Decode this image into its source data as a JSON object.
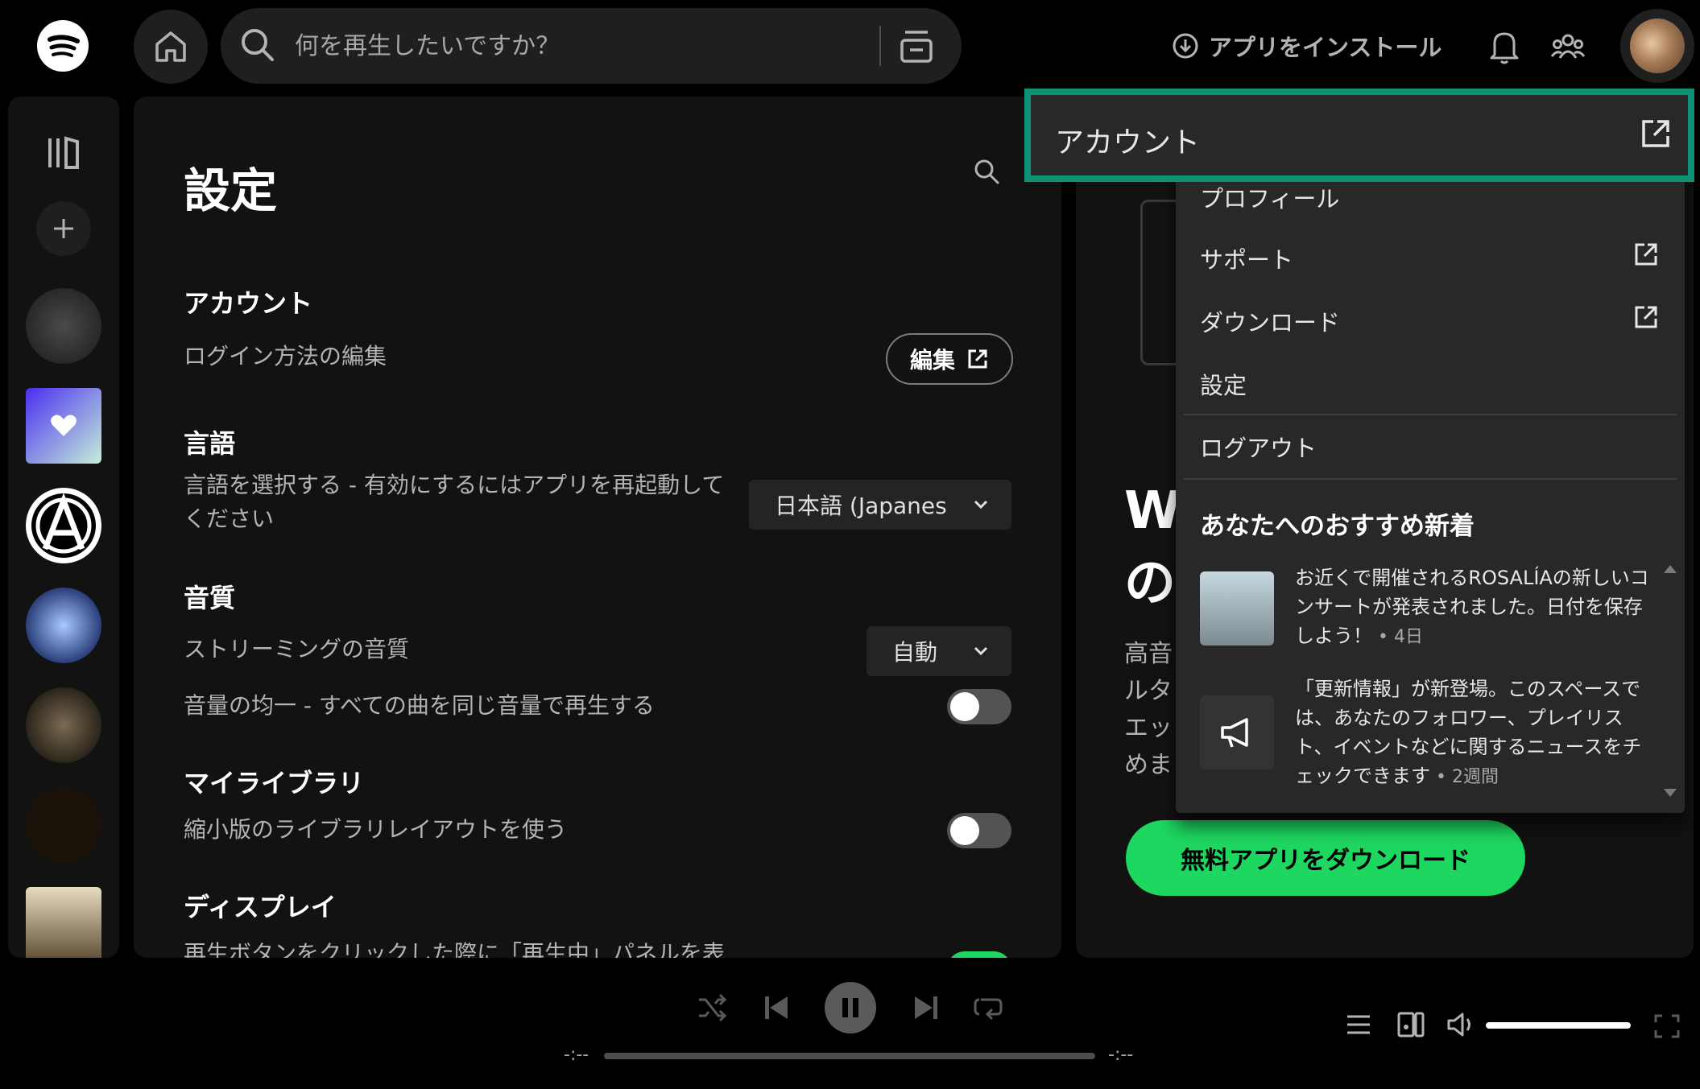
{
  "topbar": {
    "search_placeholder": "何を再生したいですか？",
    "install_label": "アプリをインストール"
  },
  "settings": {
    "title": "設定",
    "account": {
      "heading": "アカウント",
      "row": "ログイン方法の編集",
      "button": "編集"
    },
    "language": {
      "heading": "言語",
      "row_line1": "言語を選択する - 有効にするにはアプリを再起動して",
      "row_line2": "ください",
      "selected": "日本語 (Japanes"
    },
    "quality": {
      "heading": "音質",
      "streaming": "ストリーミングの音質",
      "streaming_value": "自動",
      "normalize": "音量の均一 - すべての曲を同じ音量で再生する"
    },
    "library": {
      "heading": "マイライブラリ",
      "compact": "縮小版のライブラリレイアウトを使う"
    },
    "display": {
      "heading": "ディスプレイ",
      "row_partial": "再生ボタンをクリックした際に「再生中」パネルを表"
    }
  },
  "right_panel": {
    "big_text_1": "W",
    "big_text_2": "の",
    "jp_1": "高音",
    "jp_2": "ルタ",
    "jp_3": "エッ",
    "jp_4": "めま",
    "download_button": "無料アプリをダウンロード"
  },
  "menu": {
    "account": "アカウント",
    "profile": "プロフィール",
    "support": "サポート",
    "download": "ダウンロード",
    "settings": "設定",
    "logout": "ログアウト",
    "notifications_title": "あなたへのおすすめ新着",
    "notif1_text": "お近くで開催されるROSALÍAの新しいコンサートが発表されました。日付を保存しよう！",
    "notif1_time": " • 4日",
    "notif2_text": "「更新情報」が新登場。このスペースでは、あなたのフォロワー、プレイリスト、イベントなどに関するニュースをチェックできます",
    "notif2_time": " • 2週間"
  },
  "player": {
    "time_elapsed": "-:--",
    "time_total": "-:--",
    "volume_level": 1.0
  },
  "colors": {
    "accent_green": "#1ed760",
    "highlight_box": "#0d9276",
    "panel_bg": "#121212",
    "menu_bg": "#282828"
  }
}
